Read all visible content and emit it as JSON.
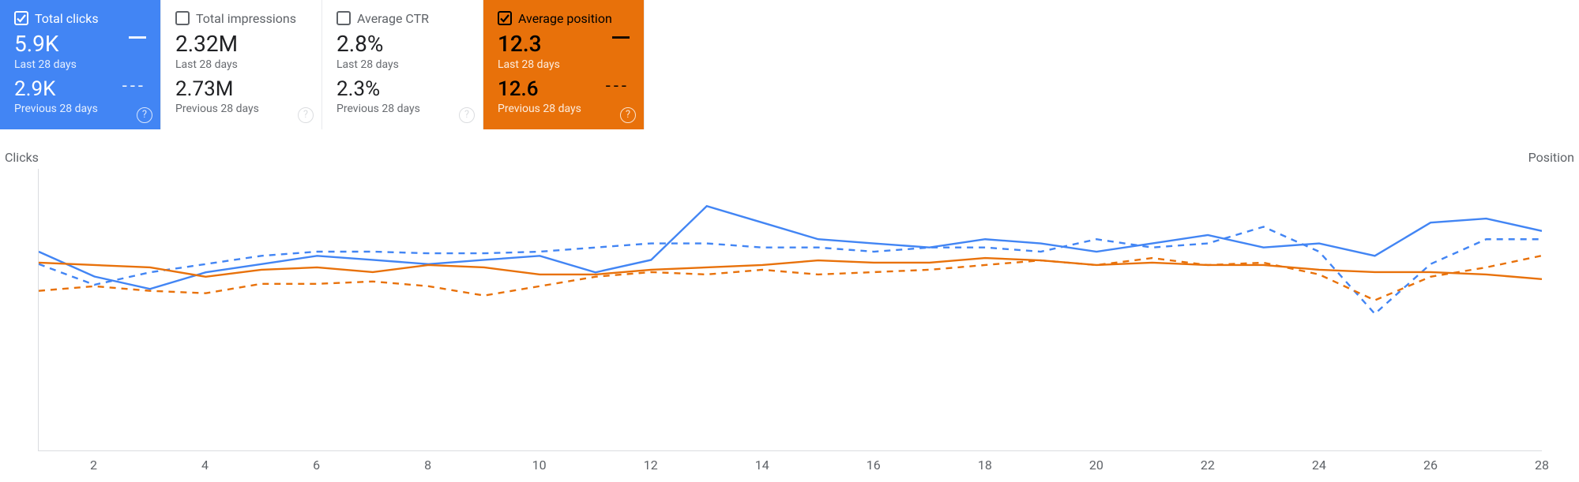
{
  "cards": [
    {
      "id": "total-clicks",
      "checked": true,
      "title": "Total clicks",
      "value1": "5.9K",
      "period1": "Last 28 days",
      "value2": "2.9K",
      "period2": "Previous 28 days",
      "indicator": true,
      "variant": "blue"
    },
    {
      "id": "total-impressions",
      "checked": false,
      "title": "Total impressions",
      "value1": "2.32M",
      "period1": "Last 28 days",
      "value2": "2.73M",
      "period2": "Previous 28 days",
      "indicator": false,
      "variant": "gray"
    },
    {
      "id": "average-ctr",
      "checked": false,
      "title": "Average CTR",
      "value1": "2.8%",
      "period1": "Last 28 days",
      "value2": "2.3%",
      "period2": "Previous 28 days",
      "indicator": false,
      "variant": "gray"
    },
    {
      "id": "average-position",
      "checked": true,
      "title": "Average position",
      "value1": "12.3",
      "period1": "Last 28 days",
      "value2": "12.6",
      "period2": "Previous 28 days",
      "indicator": true,
      "variant": "orange"
    }
  ],
  "axis": {
    "left": "Clicks",
    "right": "Position"
  },
  "chart_data": {
    "type": "line",
    "x": [
      1,
      2,
      3,
      4,
      5,
      6,
      7,
      8,
      9,
      10,
      11,
      12,
      13,
      14,
      15,
      16,
      17,
      18,
      19,
      20,
      21,
      22,
      23,
      24,
      25,
      26,
      27,
      28
    ],
    "x_ticks": [
      2,
      4,
      6,
      8,
      10,
      12,
      14,
      16,
      18,
      20,
      22,
      24,
      26,
      28
    ],
    "series": [
      {
        "name": "Clicks – Last 28 days",
        "axis": "left",
        "style": "solid",
        "color": "#4285f4",
        "values": [
          240,
          210,
          195,
          215,
          225,
          235,
          230,
          225,
          230,
          235,
          215,
          230,
          295,
          275,
          255,
          250,
          245,
          255,
          250,
          240,
          250,
          260,
          245,
          250,
          235,
          275,
          280,
          265
        ]
      },
      {
        "name": "Clicks – Previous 28 days",
        "axis": "left",
        "style": "dashed",
        "color": "#4285f4",
        "values": [
          225,
          200,
          215,
          225,
          235,
          240,
          240,
          238,
          238,
          240,
          245,
          250,
          250,
          245,
          245,
          240,
          245,
          245,
          240,
          255,
          245,
          250,
          270,
          240,
          165,
          225,
          255,
          255
        ]
      },
      {
        "name": "Position – Last 28 days",
        "axis": "right",
        "style": "solid",
        "color": "#e8710a",
        "values": [
          12.0,
          12.1,
          12.2,
          12.6,
          12.3,
          12.2,
          12.4,
          12.1,
          12.2,
          12.5,
          12.5,
          12.3,
          12.2,
          12.1,
          11.9,
          12.0,
          12.0,
          11.8,
          11.9,
          12.1,
          12.0,
          12.1,
          12.1,
          12.3,
          12.4,
          12.4,
          12.5,
          12.7
        ]
      },
      {
        "name": "Position – Previous 28 days",
        "axis": "right",
        "style": "dashed",
        "color": "#e8710a",
        "values": [
          13.2,
          13.0,
          13.2,
          13.3,
          12.9,
          12.9,
          12.8,
          13.0,
          13.4,
          13.0,
          12.6,
          12.4,
          12.5,
          12.3,
          12.5,
          12.4,
          12.3,
          12.1,
          11.9,
          12.1,
          11.8,
          12.1,
          12.0,
          12.5,
          13.6,
          12.6,
          12.2,
          11.7
        ]
      }
    ],
    "left_range": [
      0,
      340
    ],
    "right_range": [
      20,
      8
    ],
    "title": "",
    "xlabel": "",
    "ylabel_left": "Clicks",
    "ylabel_right": "Position"
  }
}
